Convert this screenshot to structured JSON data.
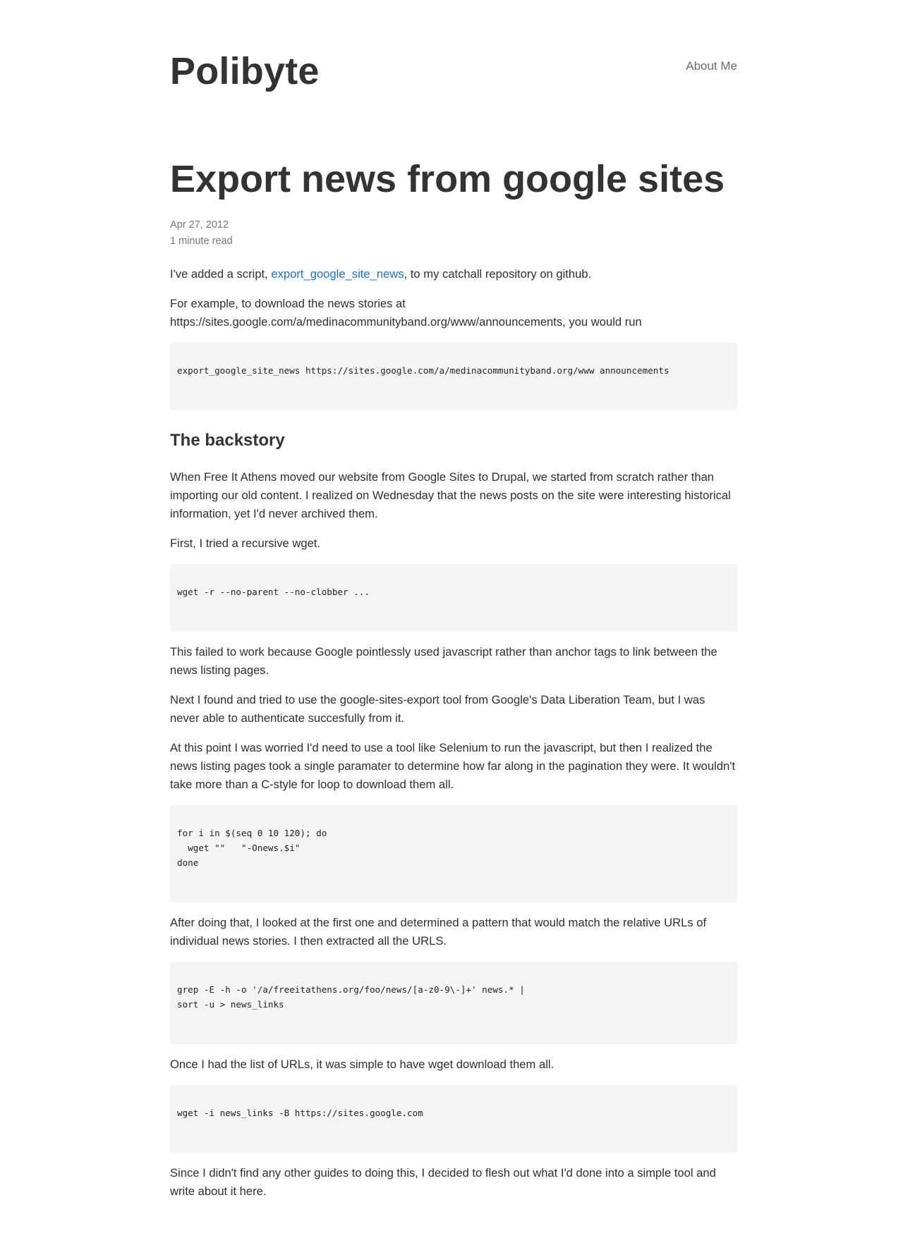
{
  "site": {
    "title": "Polibyte",
    "nav": [
      {
        "label": "About Me"
      }
    ]
  },
  "post": {
    "title": "Export news from google sites",
    "date": "Apr 27, 2012",
    "read_time": "1 minute read",
    "intro": {
      "before_link": "I've added a script, ",
      "link_text": "export_google_site_news",
      "after_link": ", to my catchall repository on github."
    },
    "paragraph_example": "For example, to download the news stories at https://sites.google.com/a/medinacommunityband.org/www/announcements, you would run",
    "code_1": [
      "export_google_site_news https://sites.google.com/a/medinacommunityband.org/www announcements"
    ],
    "section_heading": "The backstory",
    "paragraph_backstory": "When Free It Athens moved our website from Google Sites to Drupal, we started from scratch rather than importing our old content. I realized on Wednesday that the news posts on the site were interesting historical information, yet I'd never archived them.",
    "paragraph_wget": "First, I tried a recursive wget.",
    "code_2": [
      "wget -r --no-parent --no-clobber ..."
    ],
    "paragraph_failed": "This failed to work because Google pointlessly used javascript rather than anchor tags to link between the news listing pages.",
    "paragraph_next": "Next I found and tried to use the google-sites-export tool from Google's Data Liberation Team, but I was never able to authenticate succesfully from it.",
    "paragraph_selenium": "At this point I was worried I'd need to use a tool like Selenium to run the javascript, but then I realized the news listing pages took a single paramater to determine how far along in the pagination they were. It wouldn't take more than a C-style for loop to download them all.",
    "code_3": [
      "for i in $(seq 0 10 120); do",
      "  wget \"\"   \"-Onews.$i\"",
      "done"
    ],
    "paragraph_pattern": "After doing that, I looked at the first one and determined a pattern that would match the relative URLs of individual news stories. I then extracted all the URLS.",
    "code_4": [
      "grep -E -h -o '/a/freeitathens.org/foo/news/[a-z0-9\\-]+' news.* |",
      "sort -u > news_links"
    ],
    "paragraph_list": "Once I had the list of URLs, it was simple to have wget download them all.",
    "code_5": [
      "wget -i news_links -B https://sites.google.com"
    ],
    "paragraph_closing": "Since I didn't find any other guides to doing this, I decided to flesh out what I'd done into a simple tool and write about it here."
  },
  "colors": {
    "text": "#333333",
    "muted": "#767676",
    "link": "#1a73c8",
    "code_bg": "#f4f4f4"
  }
}
